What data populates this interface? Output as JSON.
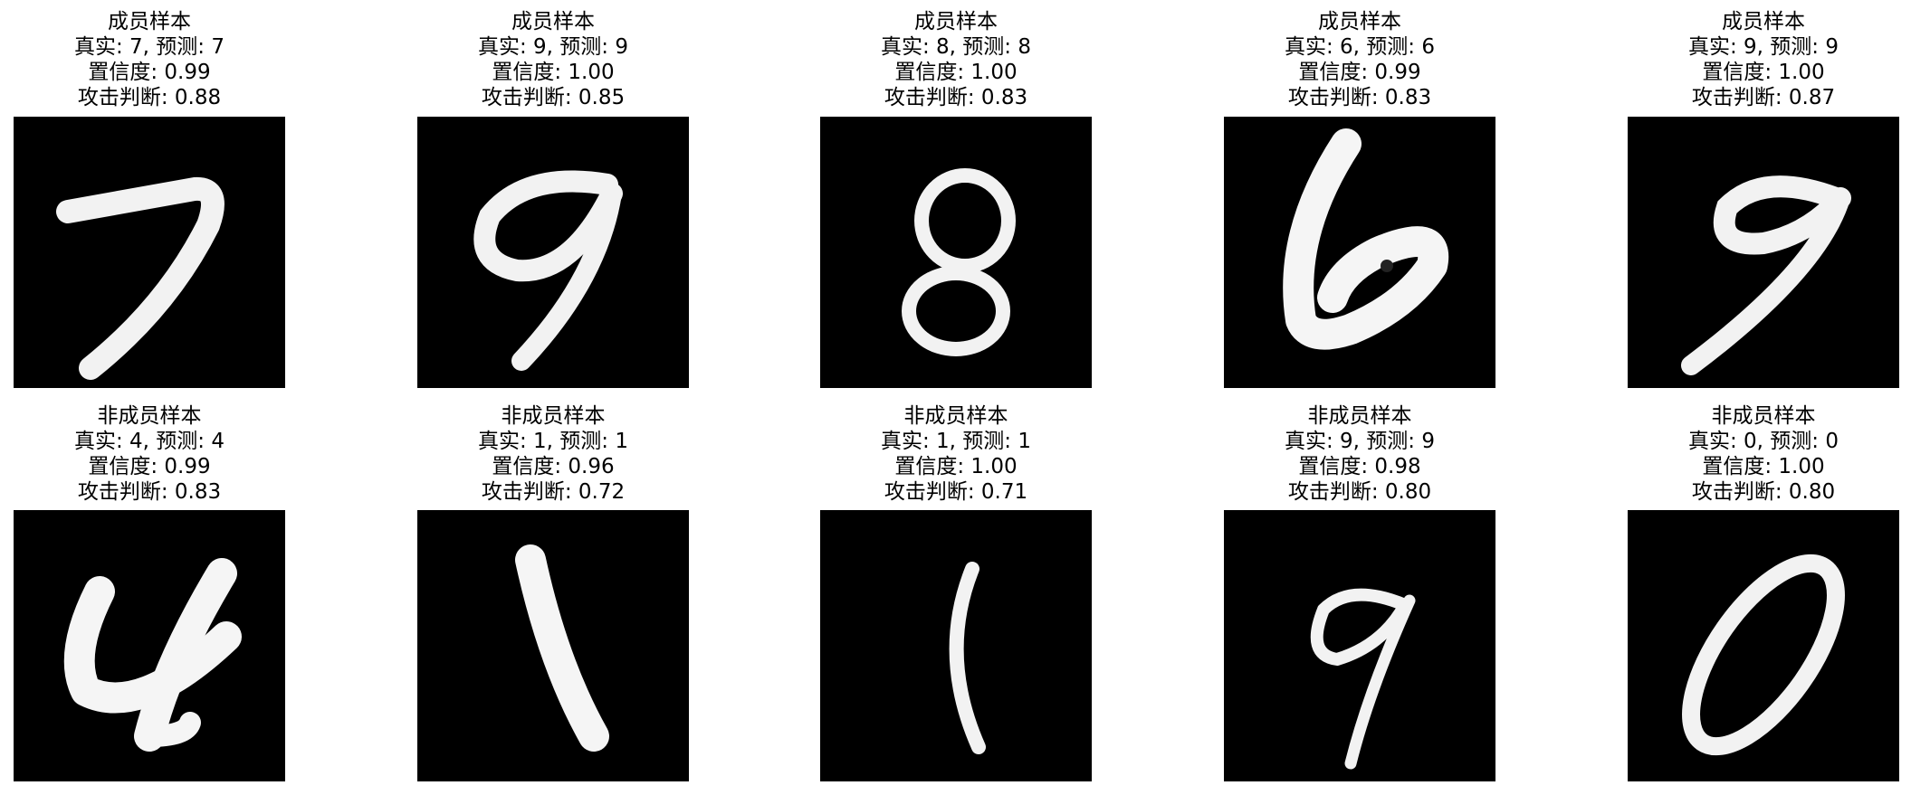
{
  "samples": [
    {
      "group": "成员样本",
      "truth_line": "真实: 7, 预测: 7",
      "conf_line": "置信度: 0.99",
      "attack_line": "攻击判断: 0.88",
      "digit": "7"
    },
    {
      "group": "成员样本",
      "truth_line": "真实: 9, 预测: 9",
      "conf_line": "置信度: 1.00",
      "attack_line": "攻击判断: 0.85",
      "digit": "9"
    },
    {
      "group": "成员样本",
      "truth_line": "真实: 8, 预测: 8",
      "conf_line": "置信度: 1.00",
      "attack_line": "攻击判断: 0.83",
      "digit": "8"
    },
    {
      "group": "成员样本",
      "truth_line": "真实: 6, 预测: 6",
      "conf_line": "置信度: 0.99",
      "attack_line": "攻击判断: 0.83",
      "digit": "6"
    },
    {
      "group": "成员样本",
      "truth_line": "真实: 9, 预测: 9",
      "conf_line": "置信度: 1.00",
      "attack_line": "攻击判断: 0.87",
      "digit": "9"
    },
    {
      "group": "非成员样本",
      "truth_line": "真实: 4, 预测: 4",
      "conf_line": "置信度: 0.99",
      "attack_line": "攻击判断: 0.83",
      "digit": "4"
    },
    {
      "group": "非成员样本",
      "truth_line": "真实: 1, 预测: 1",
      "conf_line": "置信度: 0.96",
      "attack_line": "攻击判断: 0.72",
      "digit": "1"
    },
    {
      "group": "非成员样本",
      "truth_line": "真实: 1, 预测: 1",
      "conf_line": "置信度: 1.00",
      "attack_line": "攻击判断: 0.71",
      "digit": "1"
    },
    {
      "group": "非成员样本",
      "truth_line": "真实: 9, 预测: 9",
      "conf_line": "置信度: 0.98",
      "attack_line": "攻击判断: 0.80",
      "digit": "9"
    },
    {
      "group": "非成员样本",
      "truth_line": "真实: 0, 预测: 0",
      "conf_line": "置信度: 1.00",
      "attack_line": "攻击判断: 0.80",
      "digit": "0"
    }
  ]
}
